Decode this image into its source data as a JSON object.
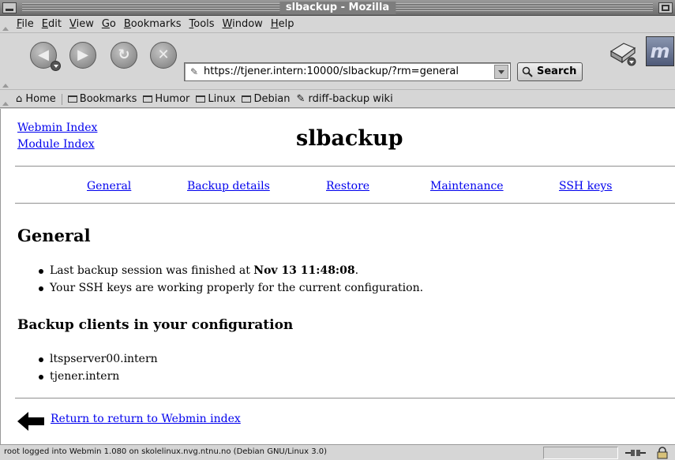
{
  "window": {
    "title": "slbackup - Mozilla"
  },
  "menubar": {
    "items": [
      "File",
      "Edit",
      "View",
      "Go",
      "Bookmarks",
      "Tools",
      "Window",
      "Help"
    ]
  },
  "navbar": {
    "back_icon": "back-arrow-icon",
    "forward_icon": "forward-arrow-icon",
    "reload_icon": "reload-icon",
    "stop_icon": "stop-icon",
    "url": "https://tjener.intern:10000/slbackup/?rm=general",
    "search_label": "Search",
    "logo_text": "m"
  },
  "personal_toolbar": {
    "home": "Home",
    "bookmarks": "Bookmarks",
    "folders": [
      "Humor",
      "Linux",
      "Debian"
    ],
    "link": "rdiff-backup wiki"
  },
  "page": {
    "webmin_index": "Webmin Index",
    "module_index": "Module Index",
    "title": "slbackup",
    "tabs": [
      "General",
      "Backup details",
      "Restore",
      "Maintenance",
      "SSH keys"
    ],
    "section_heading": "General",
    "status_items": {
      "last_backup_prefix": "Last backup session was finished at ",
      "last_backup_time": "Nov 13 11:48:08",
      "last_backup_suffix": ".",
      "ssh_status": "Your SSH keys are working properly for the current configuration."
    },
    "clients_heading": "Backup clients in your configuration",
    "clients": [
      "ltspserver00.intern",
      "tjener.intern"
    ],
    "return_link": "Return to return to Webmin index"
  },
  "statusbar": {
    "text": "root logged into Webmin 1.080 on skolelinux.nvg.ntnu.no (Debian GNU/Linux 3.0)"
  },
  "colors": {
    "link": "#0000ee",
    "chrome": "#d6d6d6",
    "titlebar": "#7d7d7d"
  }
}
